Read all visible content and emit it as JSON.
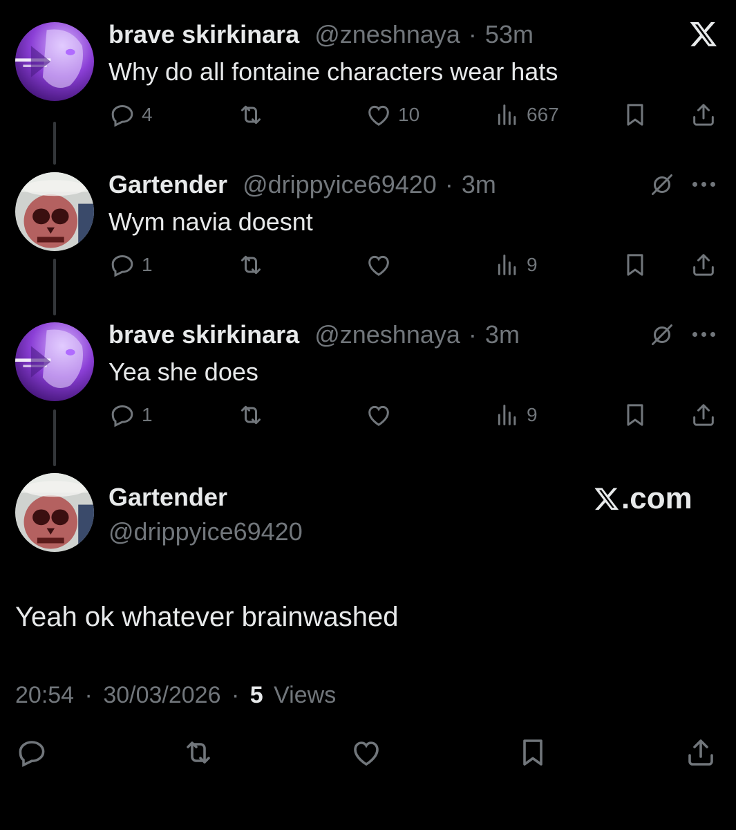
{
  "posts": [
    {
      "name": "brave skirkinara",
      "handle": "@zneshnaya",
      "separator": "·",
      "time": "53m",
      "text": "Why do all fontaine characters wear hats",
      "replies": "4",
      "reposts": "",
      "likes": "10",
      "views": "667",
      "avatar_icon": "anime-avatar"
    },
    {
      "name": "Gartender",
      "handle": "@drippyice69420",
      "separator": "·",
      "time": "3m",
      "text": "Wym navia doesnt",
      "replies": "1",
      "reposts": "",
      "likes": "",
      "views": "9",
      "avatar_icon": "skull-avatar"
    },
    {
      "name": "brave skirkinara",
      "handle": "@zneshnaya",
      "separator": "·",
      "time": "3m",
      "text": "Yea she does",
      "replies": "1",
      "reposts": "",
      "likes": "",
      "views": "9",
      "avatar_icon": "anime-avatar"
    }
  ],
  "main_post": {
    "name": "Gartender",
    "handle": "@drippyice69420",
    "text": "Yeah ok whatever brainwashed",
    "time": "20:54",
    "date": "30/03/2026",
    "separator": "·",
    "views_count": "5",
    "views_label": "Views",
    "brand": ".com"
  },
  "colors": {
    "background": "#000000",
    "text": "#e7e9ea",
    "muted": "#71767b",
    "thread_line": "#333639",
    "avatar_purple": "#8b3fd6"
  },
  "icons": [
    "x-logo-icon",
    "reply-icon",
    "repost-icon",
    "like-icon",
    "views-icon",
    "bookmark-icon",
    "share-icon",
    "grok-icon",
    "more-icon"
  ]
}
